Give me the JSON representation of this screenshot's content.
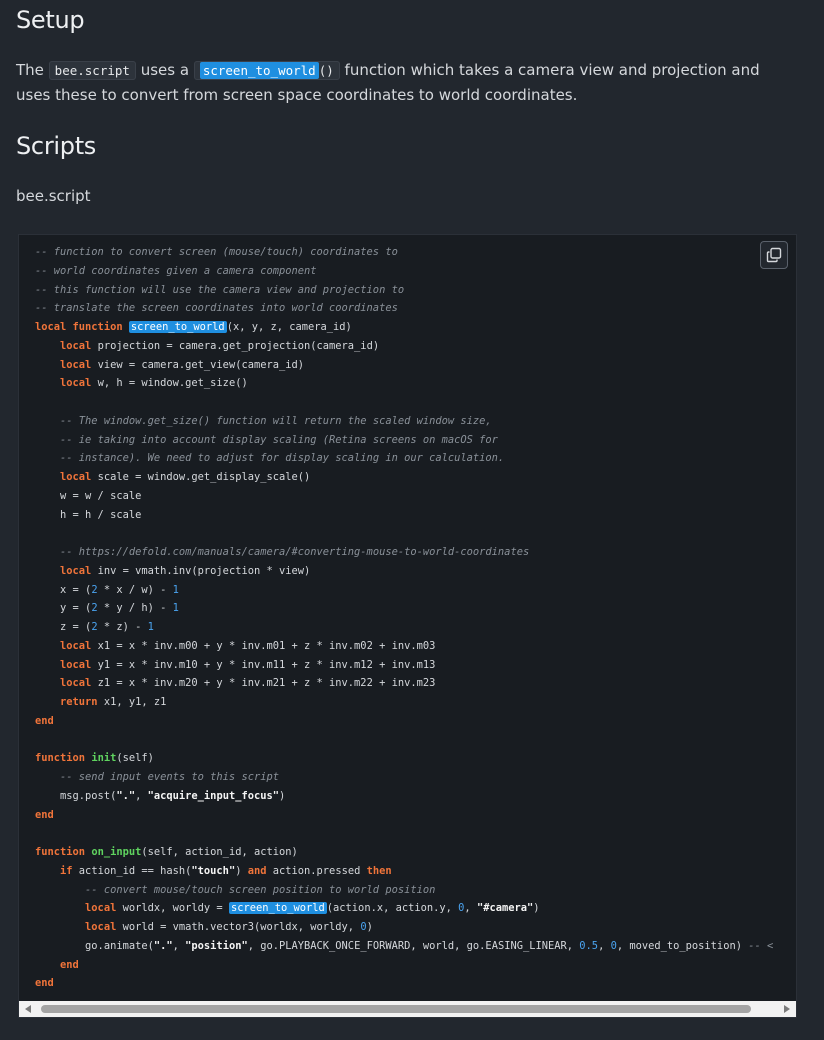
{
  "setup": {
    "heading": "Setup",
    "p_the": "The ",
    "code_file": "bee.script",
    "p_uses": " uses a ",
    "code_fn_hl": "screen_to_world",
    "code_fn_parens": "()",
    "p_rest": " function which takes a camera view and projection and uses these to convert from screen space coordinates to world coordinates."
  },
  "scripts": {
    "heading": "Scripts",
    "file_label": "bee.script"
  },
  "code": {
    "highlight": "screen_to_world",
    "copy_icon": "copy-icon",
    "lines": [
      [
        [
          "c",
          "-- function to convert screen (mouse/touch) coordinates to"
        ]
      ],
      [
        [
          "c",
          "-- world coordinates given a camera component"
        ]
      ],
      [
        [
          "c",
          "-- this function will use the camera view and projection to"
        ]
      ],
      [
        [
          "c",
          "-- translate the screen coordinates into world coordinates"
        ]
      ],
      [
        [
          "k",
          "local function "
        ],
        [
          "h",
          "screen_to_world"
        ],
        [
          "t",
          "(x, y, z, camera_id)"
        ]
      ],
      [
        [
          "t",
          "    "
        ],
        [
          "k",
          "local"
        ],
        [
          "t",
          " projection = camera.get_projection(camera_id)"
        ]
      ],
      [
        [
          "t",
          "    "
        ],
        [
          "k",
          "local"
        ],
        [
          "t",
          " view = camera.get_view(camera_id)"
        ]
      ],
      [
        [
          "t",
          "    "
        ],
        [
          "k",
          "local"
        ],
        [
          "t",
          " w, h = window.get_size()"
        ]
      ],
      [
        [
          "t",
          ""
        ]
      ],
      [
        [
          "t",
          "    "
        ],
        [
          "c",
          "-- The window.get_size() function will return the scaled window size,"
        ]
      ],
      [
        [
          "t",
          "    "
        ],
        [
          "c",
          "-- ie taking into account display scaling (Retina screens on macOS for"
        ]
      ],
      [
        [
          "t",
          "    "
        ],
        [
          "c",
          "-- instance). We need to adjust for display scaling in our calculation."
        ]
      ],
      [
        [
          "t",
          "    "
        ],
        [
          "k",
          "local"
        ],
        [
          "t",
          " scale = window.get_display_scale()"
        ]
      ],
      [
        [
          "t",
          "    w = w / scale"
        ]
      ],
      [
        [
          "t",
          "    h = h / scale"
        ]
      ],
      [
        [
          "t",
          ""
        ]
      ],
      [
        [
          "t",
          "    "
        ],
        [
          "c",
          "-- https://defold.com/manuals/camera/#converting-mouse-to-world-coordinates"
        ]
      ],
      [
        [
          "t",
          "    "
        ],
        [
          "k",
          "local"
        ],
        [
          "t",
          " inv = vmath.inv(projection * view)"
        ]
      ],
      [
        [
          "t",
          "    x = ("
        ],
        [
          "n",
          "2"
        ],
        [
          "t",
          " * x / w) - "
        ],
        [
          "n",
          "1"
        ]
      ],
      [
        [
          "t",
          "    y = ("
        ],
        [
          "n",
          "2"
        ],
        [
          "t",
          " * y / h) - "
        ],
        [
          "n",
          "1"
        ]
      ],
      [
        [
          "t",
          "    z = ("
        ],
        [
          "n",
          "2"
        ],
        [
          "t",
          " * z) - "
        ],
        [
          "n",
          "1"
        ]
      ],
      [
        [
          "t",
          "    "
        ],
        [
          "k",
          "local"
        ],
        [
          "t",
          " x1 = x * inv.m00 + y * inv.m01 + z * inv.m02 + inv.m03"
        ]
      ],
      [
        [
          "t",
          "    "
        ],
        [
          "k",
          "local"
        ],
        [
          "t",
          " y1 = x * inv.m10 + y * inv.m11 + z * inv.m12 + inv.m13"
        ]
      ],
      [
        [
          "t",
          "    "
        ],
        [
          "k",
          "local"
        ],
        [
          "t",
          " z1 = x * inv.m20 + y * inv.m21 + z * inv.m22 + inv.m23"
        ]
      ],
      [
        [
          "t",
          "    "
        ],
        [
          "k",
          "return"
        ],
        [
          "t",
          " x1, y1, z1"
        ]
      ],
      [
        [
          "k",
          "end"
        ]
      ],
      [
        [
          "t",
          ""
        ]
      ],
      [
        [
          "k",
          "function "
        ],
        [
          "f",
          "init"
        ],
        [
          "t",
          "(self)"
        ]
      ],
      [
        [
          "t",
          "    "
        ],
        [
          "c",
          "-- send input events to this script"
        ]
      ],
      [
        [
          "t",
          "    msg.post("
        ],
        [
          "s",
          "\".\""
        ],
        [
          "t",
          ", "
        ],
        [
          "s",
          "\"acquire_input_focus\""
        ],
        [
          "t",
          ")"
        ]
      ],
      [
        [
          "k",
          "end"
        ]
      ],
      [
        [
          "t",
          ""
        ]
      ],
      [
        [
          "k",
          "function "
        ],
        [
          "f",
          "on_input"
        ],
        [
          "t",
          "(self, action_id, action)"
        ]
      ],
      [
        [
          "t",
          "    "
        ],
        [
          "k",
          "if"
        ],
        [
          "t",
          " action_id == hash("
        ],
        [
          "s",
          "\"touch\""
        ],
        [
          "t",
          ") "
        ],
        [
          "k",
          "and"
        ],
        [
          "t",
          " action.pressed "
        ],
        [
          "k",
          "then"
        ]
      ],
      [
        [
          "t",
          "        "
        ],
        [
          "c",
          "-- convert mouse/touch screen position to world position"
        ]
      ],
      [
        [
          "t",
          "        "
        ],
        [
          "k",
          "local"
        ],
        [
          "t",
          " worldx, worldy = "
        ],
        [
          "h",
          "screen_to_world"
        ],
        [
          "t",
          "(action.x, action.y, "
        ],
        [
          "n",
          "0"
        ],
        [
          "t",
          ", "
        ],
        [
          "s",
          "\"#camera\""
        ],
        [
          "t",
          ")"
        ]
      ],
      [
        [
          "t",
          "        "
        ],
        [
          "k",
          "local"
        ],
        [
          "t",
          " world = vmath.vector3(worldx, worldy, "
        ],
        [
          "n",
          "0"
        ],
        [
          "t",
          ")"
        ]
      ],
      [
        [
          "t",
          "        go.animate("
        ],
        [
          "s",
          "\".\""
        ],
        [
          "t",
          ", "
        ],
        [
          "s",
          "\"position\""
        ],
        [
          "t",
          ", go.PLAYBACK_ONCE_FORWARD, world, go.EASING_LINEAR, "
        ],
        [
          "n",
          "0.5"
        ],
        [
          "t",
          ", "
        ],
        [
          "n",
          "0"
        ],
        [
          "t",
          ", moved_to_position) "
        ],
        [
          "c",
          "-- <"
        ]
      ],
      [
        [
          "t",
          "    "
        ],
        [
          "k",
          "end"
        ]
      ],
      [
        [
          "k",
          "end"
        ]
      ]
    ]
  }
}
